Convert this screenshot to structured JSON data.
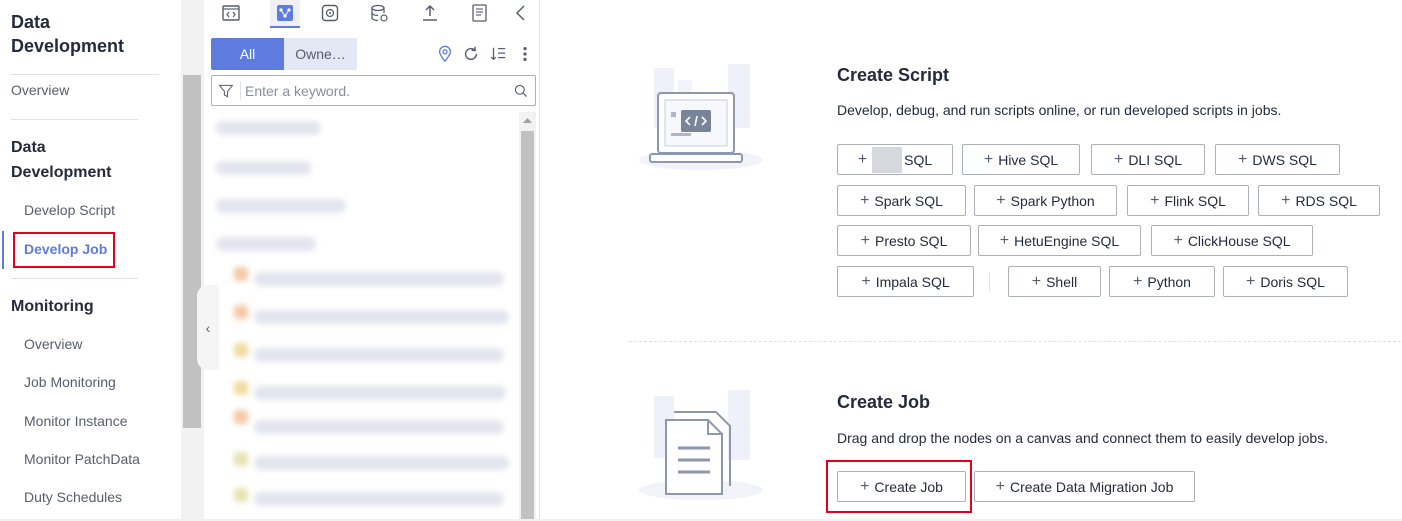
{
  "nav": {
    "title_line1": "Data",
    "title_line2": "Development",
    "overview": "Overview",
    "section1_line1": "Data",
    "section1_line2": "Development",
    "develop_script": "Develop Script",
    "develop_job": "Develop Job",
    "section2": "Monitoring",
    "monitoring_items": [
      "Overview",
      "Job Monitoring",
      "Monitor Instance",
      "Monitor PatchData",
      "Duty Schedules"
    ]
  },
  "tree": {
    "toolbar_icons": [
      "script-icon",
      "job-icon",
      "component-icon",
      "database-icon",
      "upload-icon",
      "document-icon",
      "chevron-left-icon"
    ],
    "seg_all": "All",
    "seg_owner": "Owne…",
    "search_placeholder": "Enter a keyword.",
    "collapse_glyph": "‹"
  },
  "main": {
    "script": {
      "title": "Create Script",
      "desc": "Develop, debug, and run scripts online, or run developed scripts in jobs.",
      "rows": [
        [
          "SQL",
          "Hive SQL",
          "DLI SQL",
          "DWS SQL"
        ],
        [
          "Spark SQL",
          "Spark Python",
          "Flink SQL",
          "RDS SQL"
        ],
        [
          "Presto SQL",
          "HetuEngine SQL",
          "ClickHouse SQL"
        ],
        [
          "Impala SQL",
          "Shell",
          "Python",
          "Doris SQL"
        ]
      ]
    },
    "job": {
      "title": "Create Job",
      "desc": "Drag and drop the nodes on a canvas and connect them to easily develop jobs.",
      "create_job": "Create Job",
      "create_migration_job": "Create Data Migration Job"
    }
  },
  "colors": {
    "accent": "#5e7ce0",
    "highlight": "#e6001f",
    "text": "#252b3a",
    "border": "#adb0b8"
  }
}
